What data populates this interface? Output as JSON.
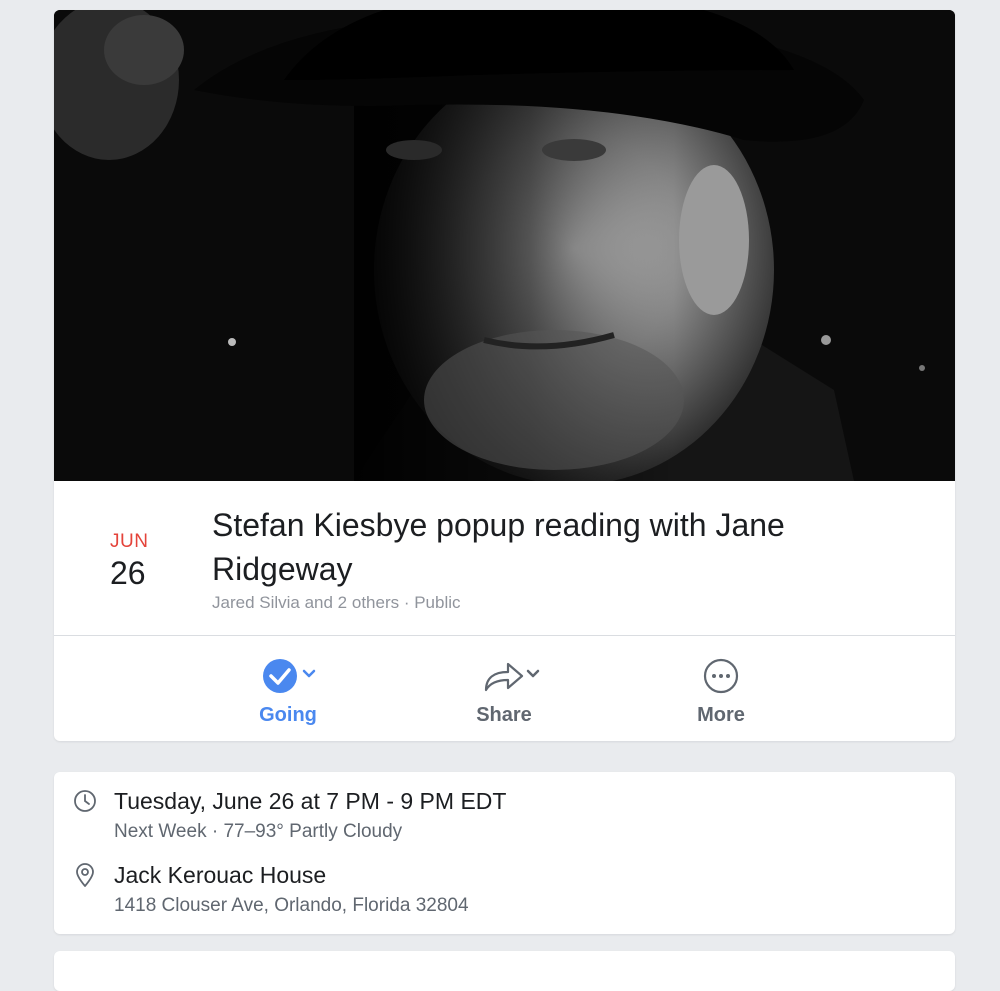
{
  "event": {
    "cover_alt": "Black and white portrait of a man in a hat at night",
    "date": {
      "month": "JUN",
      "day": "26"
    },
    "title": "Stefan Kiesbye popup reading with Jane Ridgeway",
    "meta": "Jared Silvia and 2 others · Public",
    "actions": {
      "going": {
        "label": "Going",
        "icon": "check-circle-icon"
      },
      "share": {
        "label": "Share",
        "icon": "share-arrow-icon"
      },
      "more": {
        "label": "More",
        "icon": "more-dots-icon"
      }
    },
    "accent_color": "#4a88ef",
    "date_color": "#e4433a"
  },
  "details": {
    "time": {
      "icon": "clock-icon",
      "main": "Tuesday, June 26 at 7 PM - 9 PM EDT",
      "sub": "Next Week · 77–93° Partly Cloudy"
    },
    "location": {
      "icon": "location-pin-icon",
      "main": "Jack Kerouac House",
      "sub": "1418 Clouser Ave, Orlando, Florida 32804"
    }
  }
}
